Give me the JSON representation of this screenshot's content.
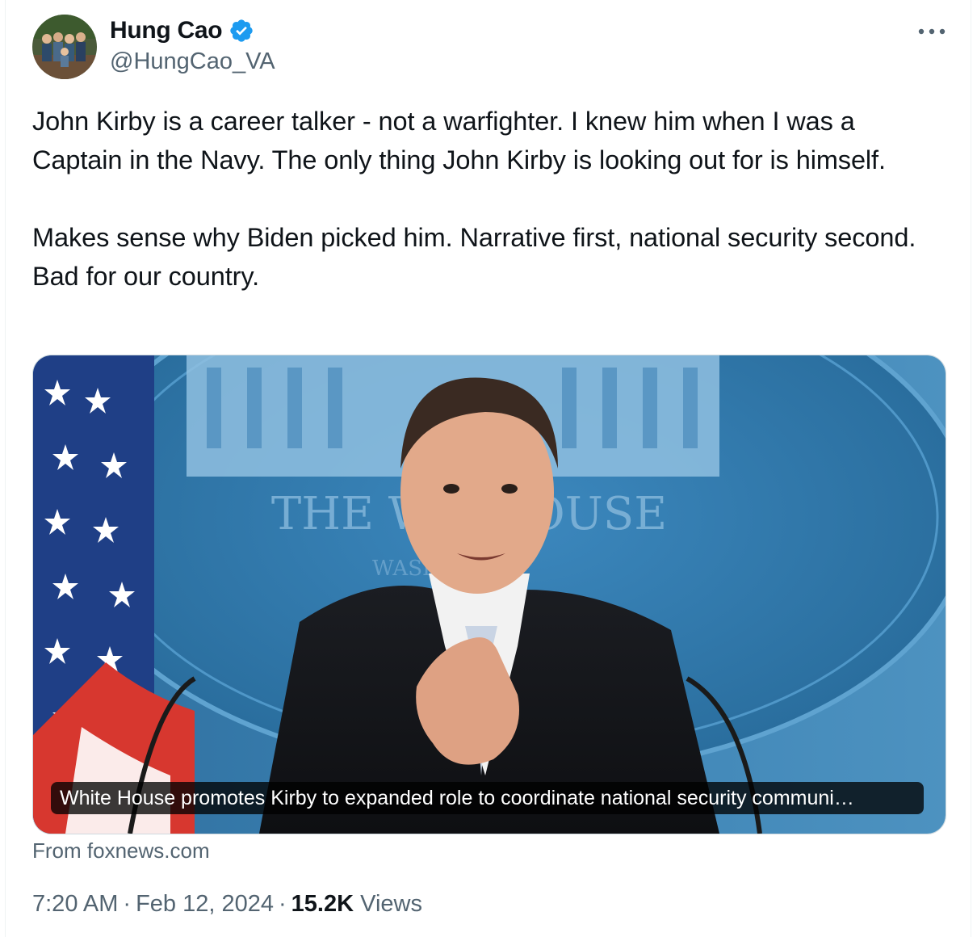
{
  "author": {
    "display_name": "Hung Cao",
    "handle": "@HungCao_VA",
    "verified": true,
    "verified_color": "#1d9bf0"
  },
  "tweet": {
    "paragraphs": [
      "John Kirby is a career talker - not a warfighter. I knew him when I was a Captain in the Navy. The only thing John Kirby is looking out for is himself.",
      "Makes sense why Biden picked him. Narrative first, national security second. Bad for our country."
    ]
  },
  "link_card": {
    "caption": "White House promotes Kirby to expanded role to coordinate national security communi…",
    "backdrop_text": "THE WH        HOUSE",
    "backdrop_subtext": "WASH",
    "source": "From foxnews.com"
  },
  "meta": {
    "time": "7:20 AM",
    "date": "Feb 12, 2024",
    "separator": "·",
    "views_count": "15.2K",
    "views_label": "Views"
  },
  "icons": {
    "more": "more-horizontal-icon",
    "verified": "verified-badge-icon"
  },
  "colors": {
    "text_primary": "#0f1419",
    "text_secondary": "#536471",
    "border": "#cfd9de",
    "accent": "#1d9bf0"
  }
}
